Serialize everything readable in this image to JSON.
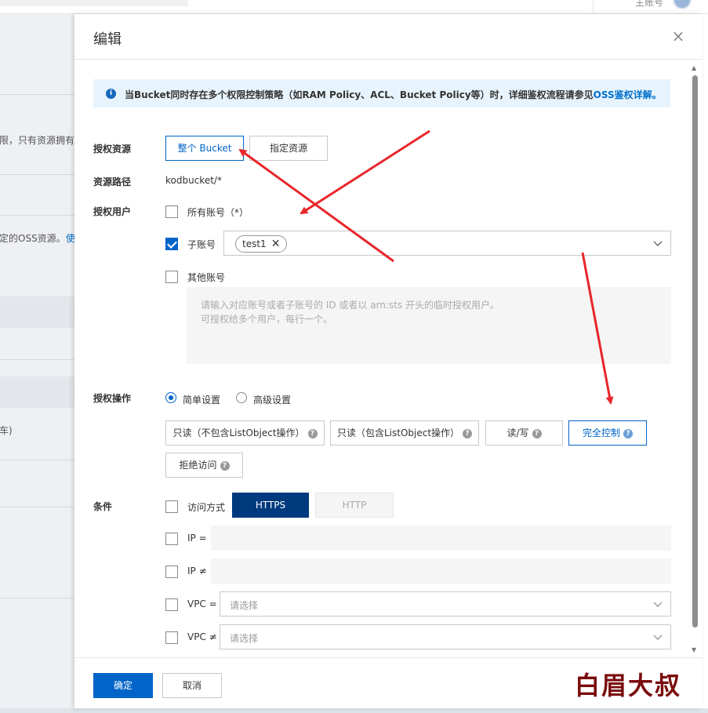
{
  "background": {
    "user_label": "主账号",
    "text_snippet_1": "限，只有资源拥有",
    "text_snippet_2": "定的OSS资源。",
    "text_snippet_2_link": "使用",
    "text_snippet_3": "车)"
  },
  "drawer": {
    "title": "编辑",
    "close_icon": "close-icon",
    "info": {
      "icon": "info-icon",
      "text": "当Bucket同时存在多个权限控制策略（如RAM Policy、ACL、Bucket Policy等）时，详细鉴权流程请参见",
      "link": "OSS鉴权详解。"
    },
    "resource": {
      "label": "授权资源",
      "options": [
        "整个 Bucket",
        "指定资源"
      ],
      "selected": "整个 Bucket"
    },
    "resource_path": {
      "label": "资源路径",
      "value": "kodbucket/*"
    },
    "users": {
      "label": "授权用户",
      "all_accounts": {
        "label": "所有账号（*）",
        "checked": false
      },
      "sub_account": {
        "label": "子账号",
        "checked": true,
        "tags": [
          "test1"
        ]
      },
      "other_accounts": {
        "label": "其他账号",
        "checked": false
      },
      "textarea_placeholder_line1": "请输入对应账号或者子账号的 ID 或者以 arn:sts 开头的临时授权用户。",
      "textarea_placeholder_line2": "可授权给多个用户，每行一个。"
    },
    "operation": {
      "label": "授权操作",
      "modes": [
        "简单设置",
        "高级设置"
      ],
      "selected_mode": "简单设置",
      "options": [
        "只读（不包含ListObject操作）",
        "只读（包含ListObject操作）",
        "读/写",
        "完全控制",
        "拒绝访问"
      ],
      "selected": "完全控制",
      "help_glyph": "?"
    },
    "conditions": {
      "label": "条件",
      "access_method": {
        "label": "访问方式",
        "options": [
          "HTTPS",
          "HTTP"
        ],
        "selected": "HTTPS",
        "checked": false
      },
      "ip_eq": {
        "label": "IP =",
        "checked": false
      },
      "ip_ne": {
        "label": "IP ≠",
        "checked": false
      },
      "vpc_eq": {
        "label": "VPC =",
        "placeholder": "请选择",
        "checked": false
      },
      "vpc_ne": {
        "label": "VPC ≠",
        "placeholder": "请选择",
        "checked": false
      }
    },
    "footer": {
      "confirm": "确定",
      "cancel": "取消",
      "watermark": "白眉大叔"
    }
  },
  "colors": {
    "primary": "#0064c8",
    "dark_primary": "#003a7e",
    "info_bg": "#e8f4fd",
    "arrow": "#e8262b"
  }
}
